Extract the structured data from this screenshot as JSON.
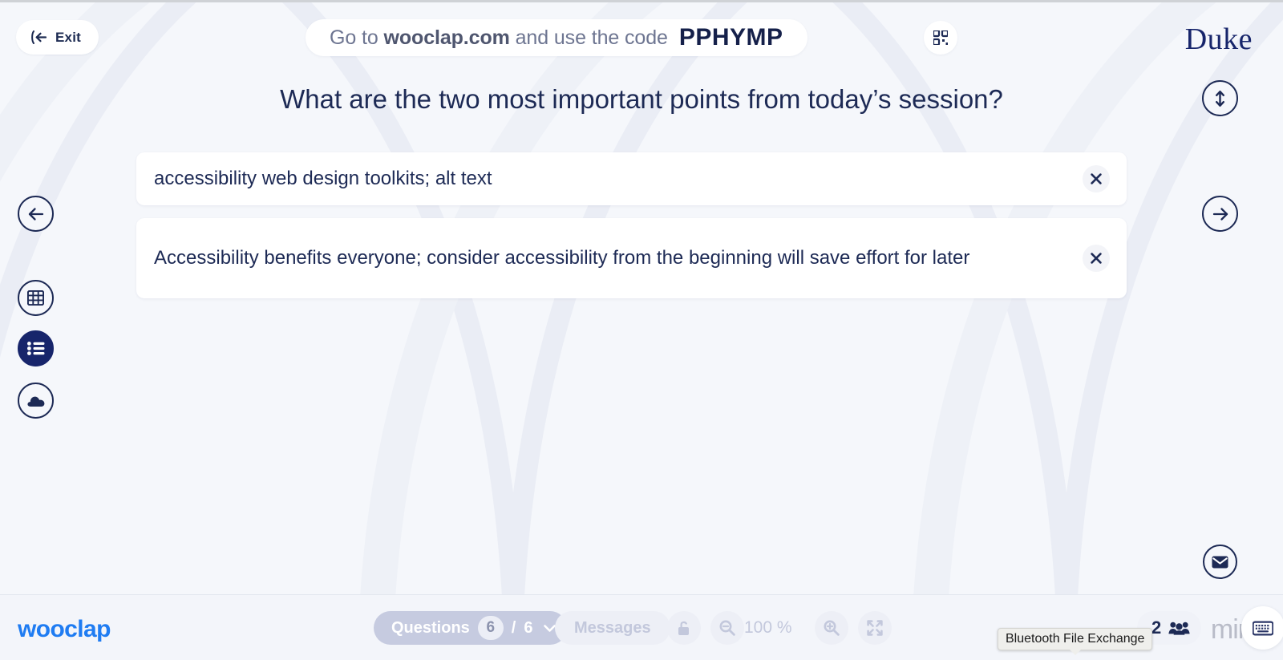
{
  "header": {
    "exit_label": "Exit",
    "exit_icon": "exit-arrow-icon",
    "banner_prefix": "Go to ",
    "banner_domain": "wooclap.com",
    "banner_middle": " and use the code",
    "code": "PPHYMP",
    "qr_icon": "qr-code-icon",
    "brand_logo": "Duke"
  },
  "question": {
    "text": "What are the two most important points from today’s session?"
  },
  "answers": [
    {
      "text": "accessibility web design toolkits; alt text",
      "close_icon": "close-icon"
    },
    {
      "text": "Accessibility benefits everyone; consider accessibility from the beginning will save effort for later",
      "close_icon": "close-icon"
    }
  ],
  "side_controls": {
    "prev_icon": "arrow-left-icon",
    "grid_icon": "grid-view-icon",
    "list_icon": "list-view-icon",
    "cloud_icon": "word-cloud-icon",
    "scroll_icon": "scroll-vertical-icon",
    "next_icon": "arrow-right-icon",
    "mail_icon": "mail-icon",
    "active_view": "list-view-icon"
  },
  "bottom_bar": {
    "logo": "wooclap",
    "questions_label": "Questions",
    "questions_current": "6",
    "questions_separator": "/",
    "questions_total": "6",
    "questions_dropdown_icon": "chevron-down-icon",
    "messages_label": "Messages",
    "lock_icon": "unlock-icon",
    "zoom_out_icon": "zoom-out-icon",
    "zoom_level": "100 %",
    "zoom_in_icon": "zoom-in-icon",
    "expand_icon": "fullscreen-icon",
    "participants_count": "2",
    "participants_icon": "people-icon",
    "keyboard_icon": "keyboard-icon",
    "watermark": "miro"
  },
  "os_tooltip": {
    "text": "Bluetooth File Exchange"
  },
  "colors": {
    "brand_navy": "#17256b",
    "text_navy": "#1d2a55",
    "wooclap_blue": "#1f7cf2",
    "page_bg": "#f5f7fb",
    "card_bg": "#ffffff",
    "muted": "#c3c8dc"
  }
}
